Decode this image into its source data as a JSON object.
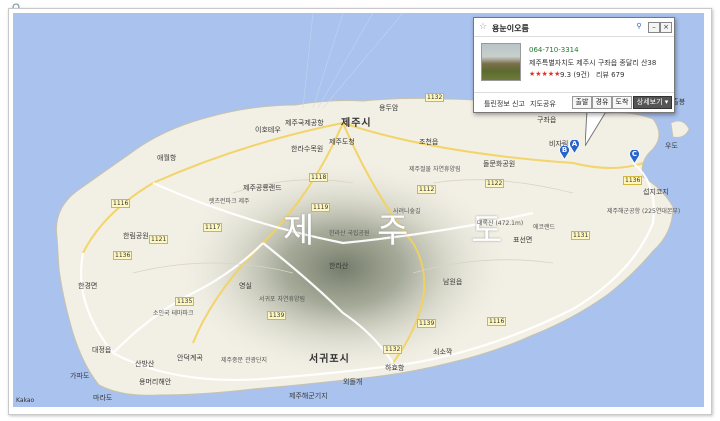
{
  "map": {
    "island_title": "제 주 도",
    "attribution": "Kakao",
    "cities": [
      {
        "name": "jeju-si",
        "label": "제주시"
      },
      {
        "name": "seogwipo-si",
        "label": "서귀포시"
      }
    ],
    "place_labels": [
      "제주국제공항",
      "이호테우",
      "용두암",
      "한라수목원",
      "제주도청",
      "애월항",
      "제주공룡랜드",
      "렛츠런파크 제주",
      "한림공원",
      "한경면",
      "대정읍",
      "소인국 테마파크",
      "산방산",
      "용머리해안",
      "안덕계곡",
      "제주중문 관광단지",
      "마라도",
      "가파도",
      "영실",
      "한라산 국립공원",
      "한라산",
      "서귀포 자연휴양림",
      "조천읍",
      "제주절물 자연휴양림",
      "비자림",
      "구좌읍",
      "표선면",
      "대록산 (472.1m)",
      "남원읍",
      "쇠소깍",
      "제주해군기지",
      "섭지코지",
      "제주해군공항 (225연대본부)",
      "성산일출봉",
      "김녕",
      "돌문화공원",
      "하효항",
      "외돌개",
      "우도",
      "사려니숲길",
      "에코랜드"
    ],
    "road_numbers": [
      "1132",
      "1116",
      "1117",
      "1118",
      "1121",
      "1135",
      "1139",
      "1136",
      "1119",
      "1131",
      "1112",
      "1122",
      "1132",
      "1139",
      "1136",
      "1116"
    ],
    "markers": [
      {
        "letter": "A"
      },
      {
        "letter": "B"
      },
      {
        "letter": "C"
      }
    ]
  },
  "popup": {
    "title": "용눈이오름",
    "phone": "064-710-3314",
    "address": "제주특별자치도 제주시 구좌읍 종달리 산38",
    "stars": "★★★★★",
    "rating": "9.3 (9건)",
    "review": "리뷰 679",
    "link_report": "틀린정보 신고",
    "link_share": "지도공유",
    "btn_depart": "출발",
    "btn_via": "경유",
    "btn_arrive": "도착",
    "btn_detail": "상세보기 ▾"
  },
  "colors": {
    "sea": "#a9c2ee",
    "land": "#f2efe4",
    "popup_green": "#1d7d2a"
  }
}
